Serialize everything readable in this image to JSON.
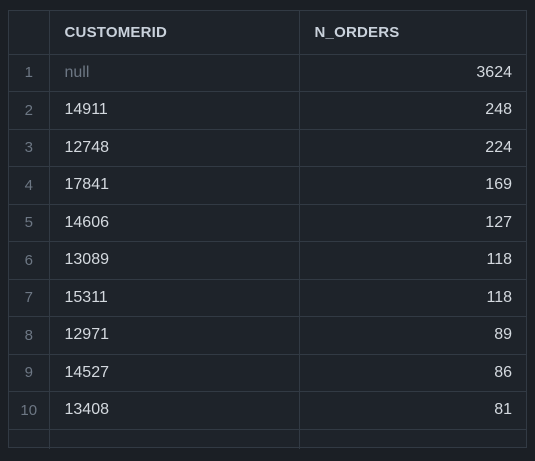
{
  "columns": [
    {
      "label": ""
    },
    {
      "label": "CUSTOMERID"
    },
    {
      "label": "N_ORDERS"
    }
  ],
  "rows": [
    {
      "index": "1",
      "customerid": "null",
      "n_orders": "3624",
      "is_null": true
    },
    {
      "index": "2",
      "customerid": "14911",
      "n_orders": "248"
    },
    {
      "index": "3",
      "customerid": "12748",
      "n_orders": "224"
    },
    {
      "index": "4",
      "customerid": "17841",
      "n_orders": "169"
    },
    {
      "index": "5",
      "customerid": "14606",
      "n_orders": "127"
    },
    {
      "index": "6",
      "customerid": "13089",
      "n_orders": "118"
    },
    {
      "index": "7",
      "customerid": "15311",
      "n_orders": "118"
    },
    {
      "index": "8",
      "customerid": "12971",
      "n_orders": "89"
    },
    {
      "index": "9",
      "customerid": "14527",
      "n_orders": "86"
    },
    {
      "index": "10",
      "customerid": "13408",
      "n_orders": "81"
    }
  ]
}
